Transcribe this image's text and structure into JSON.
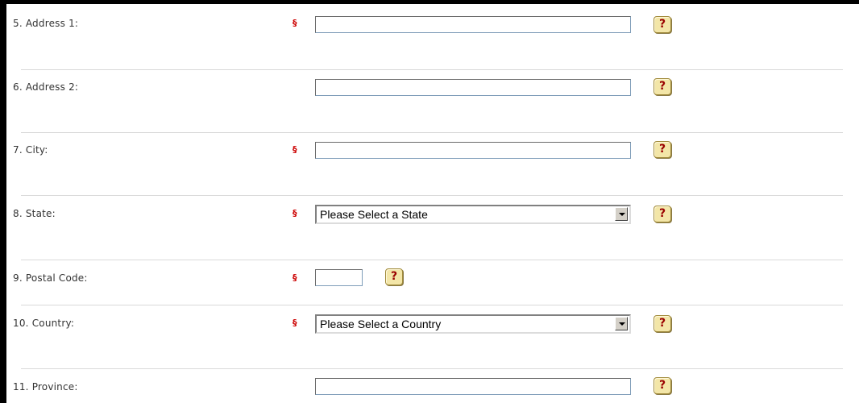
{
  "form": {
    "required_marker": "§",
    "help_glyph": "?",
    "fields": [
      {
        "label": "5. Address 1:",
        "required": true,
        "type": "text",
        "value": ""
      },
      {
        "label": "6. Address 2:",
        "required": false,
        "type": "text",
        "value": ""
      },
      {
        "label": "7. City:",
        "required": true,
        "type": "text",
        "value": ""
      },
      {
        "label": "8. State:",
        "required": true,
        "type": "select",
        "selected": "Please Select a State"
      },
      {
        "label": "9. Postal Code:",
        "required": true,
        "type": "text",
        "value": ""
      },
      {
        "label": "10. Country:",
        "required": true,
        "type": "select",
        "selected": "Please Select a Country"
      },
      {
        "label": "11. Province:",
        "required": false,
        "type": "text",
        "value": ""
      }
    ]
  },
  "colors": {
    "required_marker": "#cc0000",
    "help_button_bg": "#f3e6a8",
    "help_glyph": "#9a0000",
    "divider": "#d9d9d9"
  },
  "icons": {
    "help": "help-question-icon",
    "dropdown": "chevron-down-icon"
  }
}
